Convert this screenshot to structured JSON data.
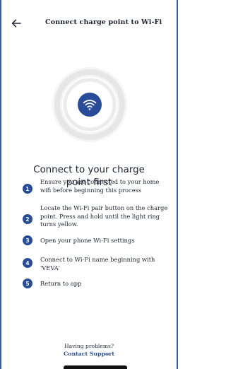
{
  "header": {
    "title": "Connect charge point to Wi-Fi",
    "back_icon": "arrow-left-icon"
  },
  "illustration": {
    "icon": "wifi-icon",
    "accent": "#274c9a"
  },
  "heading": {
    "line1": "Connect to your charge",
    "line2": "point first"
  },
  "steps": [
    {
      "number": "1",
      "lines": [
        "Ensure you are connected to your home",
        "wifi before beginning this process"
      ]
    },
    {
      "number": "2",
      "lines": [
        "Locate the Wi-Fi pair button on the charge",
        "point. Press and hold until the light ring",
        "turns yellow."
      ]
    },
    {
      "number": "3",
      "lines": [
        "Open your phone Wi-Fi settings"
      ]
    },
    {
      "number": "4",
      "lines": [
        "Connect to Wi-Fi name beginning with",
        "'VEVA'"
      ]
    },
    {
      "number": "5",
      "lines": [
        "Return to app"
      ]
    }
  ],
  "footer": {
    "problem_text": "Having problems?",
    "support_link": "Contact Support"
  },
  "colors": {
    "primary": "#274c9a",
    "frame": "#2f5db0"
  }
}
